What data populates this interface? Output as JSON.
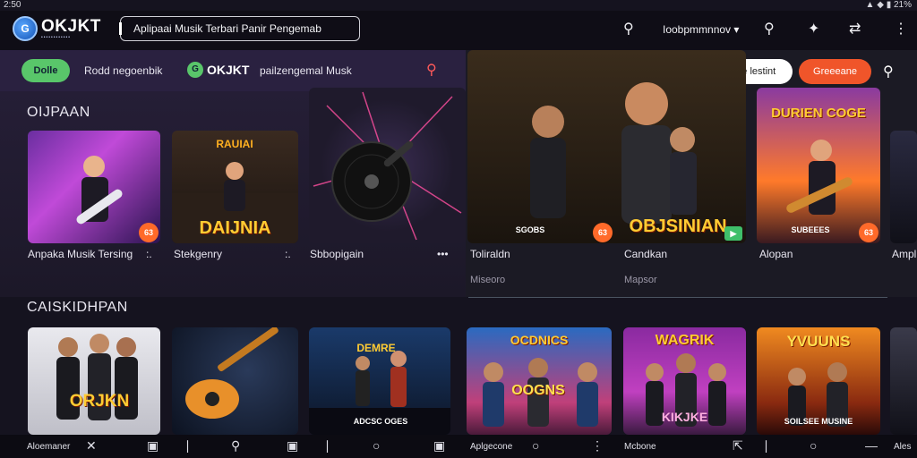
{
  "status": {
    "time": "2:50",
    "right": "▲ ◆ ▮ 21%"
  },
  "header": {
    "logo_text": "OKJKT",
    "logo_mark": "G",
    "logo_sub": "••••••••••••",
    "search_text": "Aplipaai Musik Terbari Panir Pengemab",
    "language": "Ioobpmmnnov ▾"
  },
  "filters": {
    "pill": "Dolle",
    "text1": "Rodd negoenbik",
    "badge": "G",
    "brand": "OKJKT",
    "text2": "pailzengemal Musk"
  },
  "right_actions": {
    "white_button": "Sobsebe lestint",
    "red_button": "Greeeane"
  },
  "sections": [
    {
      "title": "OIJPAAN"
    },
    {
      "title": "CAISKIDHPAN"
    }
  ],
  "row1": [
    {
      "label": "Anpaka Musik Tersing",
      "dots": ":.",
      "badge": "63",
      "overlay": ""
    },
    {
      "label": "Stekgenry",
      "dots": ":.",
      "badge": "",
      "overlay": "DAIJNIA",
      "top_overlay": "RAUIAI"
    },
    {
      "label": "Sbbopigain",
      "dots": "•••",
      "badge": "",
      "overlay": ""
    },
    {
      "label": "Toliraldn",
      "sub": "Miseoro",
      "badge": "63",
      "overlay": "OBJSINIAN",
      "top_overlay": "SGOBS"
    },
    {
      "label": "Candkan",
      "sub": "Mapsor",
      "badge": "▶",
      "overlay": ""
    },
    {
      "label": "Alopan",
      "badge": "63",
      "overlay": "SUBEEES",
      "top_overlay": "DURIEN COGE"
    },
    {
      "label": "Ampl",
      "overlay": ""
    }
  ],
  "row2": [
    {
      "overlay": "ORJKN"
    },
    {
      "overlay": ""
    },
    {
      "overlay": "ADCSC OGES",
      "top_overlay": "DEMRE"
    },
    {
      "overlay": "OOGNS",
      "top_overlay": "OCDNICS"
    },
    {
      "overlay": "KIKJKE",
      "top_overlay": "WAGRIK"
    },
    {
      "overlay": "SOILSEE MUSINE",
      "top_overlay": "YVUUNS"
    }
  ],
  "bottom_nav": {
    "left_label": "Aloemaner",
    "mid_label": "Aplgecone",
    "right_label": "Mcbone",
    "far_right": "Ales"
  },
  "colors": {
    "accent_green": "#59c66a",
    "accent_red": "#f0552a",
    "badge_orange": "#ff6a2a"
  }
}
